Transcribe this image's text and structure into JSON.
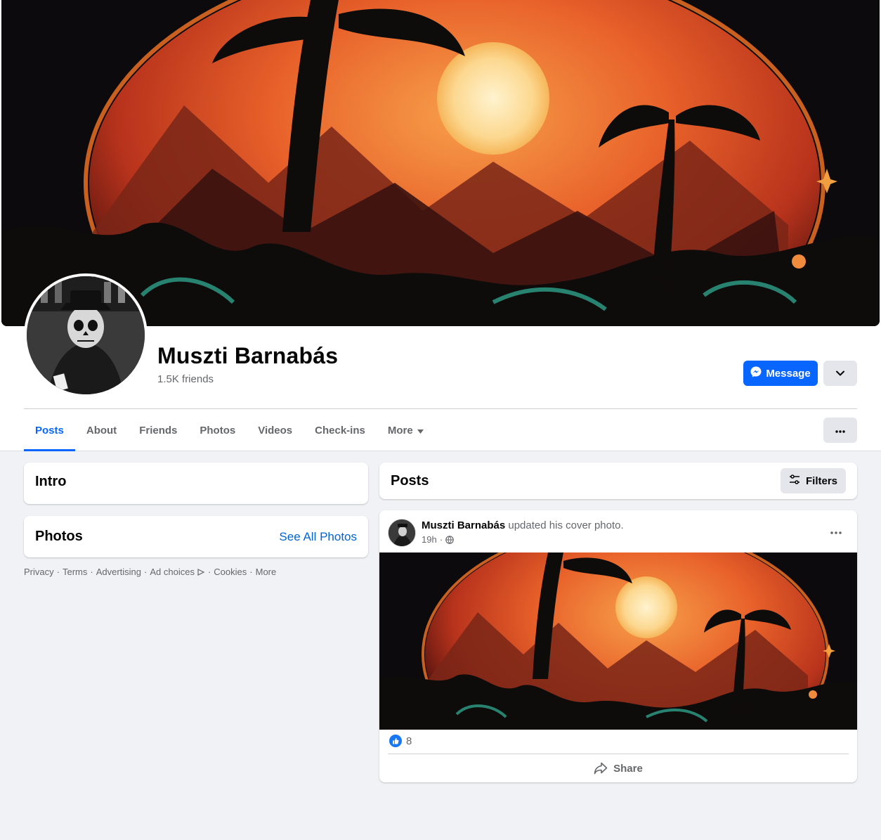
{
  "profile": {
    "name": "Muszti Barnabás",
    "friends": "1.5K friends",
    "cover_icon": "sunset-palm-art-image",
    "avatar_icon": "skull-gangster-avatar-image"
  },
  "actions": {
    "message_label": "Message",
    "message_icon": "messenger-icon",
    "dropdown_icon": "chevron-down-icon"
  },
  "tabs": [
    {
      "label": "Posts",
      "active": true
    },
    {
      "label": "About"
    },
    {
      "label": "Friends"
    },
    {
      "label": "Photos"
    },
    {
      "label": "Videos"
    },
    {
      "label": "Check-ins"
    },
    {
      "label": "More"
    }
  ],
  "sidebar": {
    "intro_title": "Intro",
    "photos_title": "Photos",
    "see_all_photos": "See All Photos"
  },
  "footer": {
    "links": [
      "Privacy",
      "Terms",
      "Advertising",
      "Ad choices",
      "Cookies",
      "More"
    ]
  },
  "posts": {
    "title": "Posts",
    "filters_label": "Filters",
    "items": [
      {
        "author": "Muszti Barnabás",
        "action": "updated his cover photo.",
        "time": "19h",
        "privacy_icon": "globe-icon",
        "like_count": "8",
        "share_label": "Share"
      }
    ]
  },
  "colors": {
    "accent": "#0866ff",
    "page_bg": "#f0f2f5",
    "secondary_text": "#65676b",
    "button_gray": "#e4e6eb"
  }
}
